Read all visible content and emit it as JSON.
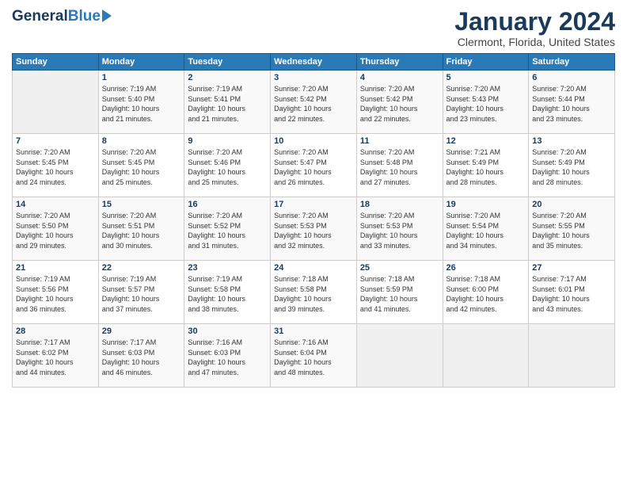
{
  "logo": {
    "general": "General",
    "blue": "Blue"
  },
  "header": {
    "title": "January 2024",
    "subtitle": "Clermont, Florida, United States"
  },
  "weekdays": [
    "Sunday",
    "Monday",
    "Tuesday",
    "Wednesday",
    "Thursday",
    "Friday",
    "Saturday"
  ],
  "weeks": [
    [
      {
        "day": "",
        "info": ""
      },
      {
        "day": "1",
        "info": "Sunrise: 7:19 AM\nSunset: 5:40 PM\nDaylight: 10 hours\nand 21 minutes."
      },
      {
        "day": "2",
        "info": "Sunrise: 7:19 AM\nSunset: 5:41 PM\nDaylight: 10 hours\nand 21 minutes."
      },
      {
        "day": "3",
        "info": "Sunrise: 7:20 AM\nSunset: 5:42 PM\nDaylight: 10 hours\nand 22 minutes."
      },
      {
        "day": "4",
        "info": "Sunrise: 7:20 AM\nSunset: 5:42 PM\nDaylight: 10 hours\nand 22 minutes."
      },
      {
        "day": "5",
        "info": "Sunrise: 7:20 AM\nSunset: 5:43 PM\nDaylight: 10 hours\nand 23 minutes."
      },
      {
        "day": "6",
        "info": "Sunrise: 7:20 AM\nSunset: 5:44 PM\nDaylight: 10 hours\nand 23 minutes."
      }
    ],
    [
      {
        "day": "7",
        "info": "Sunrise: 7:20 AM\nSunset: 5:45 PM\nDaylight: 10 hours\nand 24 minutes."
      },
      {
        "day": "8",
        "info": "Sunrise: 7:20 AM\nSunset: 5:45 PM\nDaylight: 10 hours\nand 25 minutes."
      },
      {
        "day": "9",
        "info": "Sunrise: 7:20 AM\nSunset: 5:46 PM\nDaylight: 10 hours\nand 25 minutes."
      },
      {
        "day": "10",
        "info": "Sunrise: 7:20 AM\nSunset: 5:47 PM\nDaylight: 10 hours\nand 26 minutes."
      },
      {
        "day": "11",
        "info": "Sunrise: 7:20 AM\nSunset: 5:48 PM\nDaylight: 10 hours\nand 27 minutes."
      },
      {
        "day": "12",
        "info": "Sunrise: 7:21 AM\nSunset: 5:49 PM\nDaylight: 10 hours\nand 28 minutes."
      },
      {
        "day": "13",
        "info": "Sunrise: 7:20 AM\nSunset: 5:49 PM\nDaylight: 10 hours\nand 28 minutes."
      }
    ],
    [
      {
        "day": "14",
        "info": "Sunrise: 7:20 AM\nSunset: 5:50 PM\nDaylight: 10 hours\nand 29 minutes."
      },
      {
        "day": "15",
        "info": "Sunrise: 7:20 AM\nSunset: 5:51 PM\nDaylight: 10 hours\nand 30 minutes."
      },
      {
        "day": "16",
        "info": "Sunrise: 7:20 AM\nSunset: 5:52 PM\nDaylight: 10 hours\nand 31 minutes."
      },
      {
        "day": "17",
        "info": "Sunrise: 7:20 AM\nSunset: 5:53 PM\nDaylight: 10 hours\nand 32 minutes."
      },
      {
        "day": "18",
        "info": "Sunrise: 7:20 AM\nSunset: 5:53 PM\nDaylight: 10 hours\nand 33 minutes."
      },
      {
        "day": "19",
        "info": "Sunrise: 7:20 AM\nSunset: 5:54 PM\nDaylight: 10 hours\nand 34 minutes."
      },
      {
        "day": "20",
        "info": "Sunrise: 7:20 AM\nSunset: 5:55 PM\nDaylight: 10 hours\nand 35 minutes."
      }
    ],
    [
      {
        "day": "21",
        "info": "Sunrise: 7:19 AM\nSunset: 5:56 PM\nDaylight: 10 hours\nand 36 minutes."
      },
      {
        "day": "22",
        "info": "Sunrise: 7:19 AM\nSunset: 5:57 PM\nDaylight: 10 hours\nand 37 minutes."
      },
      {
        "day": "23",
        "info": "Sunrise: 7:19 AM\nSunset: 5:58 PM\nDaylight: 10 hours\nand 38 minutes."
      },
      {
        "day": "24",
        "info": "Sunrise: 7:18 AM\nSunset: 5:58 PM\nDaylight: 10 hours\nand 39 minutes."
      },
      {
        "day": "25",
        "info": "Sunrise: 7:18 AM\nSunset: 5:59 PM\nDaylight: 10 hours\nand 41 minutes."
      },
      {
        "day": "26",
        "info": "Sunrise: 7:18 AM\nSunset: 6:00 PM\nDaylight: 10 hours\nand 42 minutes."
      },
      {
        "day": "27",
        "info": "Sunrise: 7:17 AM\nSunset: 6:01 PM\nDaylight: 10 hours\nand 43 minutes."
      }
    ],
    [
      {
        "day": "28",
        "info": "Sunrise: 7:17 AM\nSunset: 6:02 PM\nDaylight: 10 hours\nand 44 minutes."
      },
      {
        "day": "29",
        "info": "Sunrise: 7:17 AM\nSunset: 6:03 PM\nDaylight: 10 hours\nand 46 minutes."
      },
      {
        "day": "30",
        "info": "Sunrise: 7:16 AM\nSunset: 6:03 PM\nDaylight: 10 hours\nand 47 minutes."
      },
      {
        "day": "31",
        "info": "Sunrise: 7:16 AM\nSunset: 6:04 PM\nDaylight: 10 hours\nand 48 minutes."
      },
      {
        "day": "",
        "info": ""
      },
      {
        "day": "",
        "info": ""
      },
      {
        "day": "",
        "info": ""
      }
    ]
  ]
}
